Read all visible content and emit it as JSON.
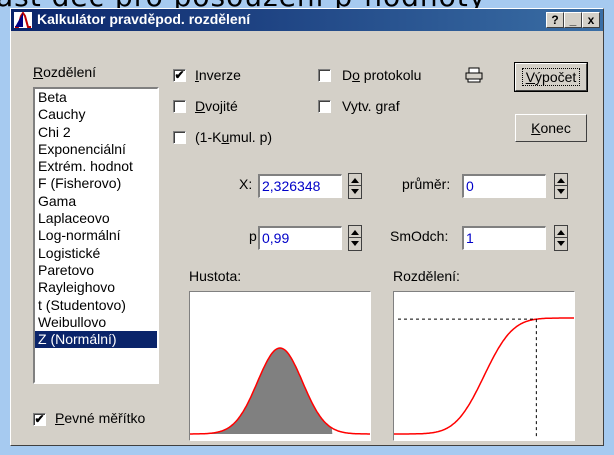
{
  "background": {
    "text": "ast dec pro posouzení p-hodnoty"
  },
  "window": {
    "title": "Kalkulátor pravděpod. rozdělení",
    "help_label": "?",
    "minimize_label": "_",
    "close_label": "x"
  },
  "distribution": {
    "label_underline": "R",
    "label_rest": "ozdělení",
    "items": [
      "Beta",
      "Cauchy",
      "Chi 2",
      "Exponenciální",
      "Extrém. hodnot",
      "F (Fisherovo)",
      "Gama",
      "Laplaceovo",
      "Log-normální",
      "Logistické",
      "Paretovo",
      "Rayleighovo",
      "t (Studentovo)",
      "Weibullovo",
      "Z (Normální)"
    ],
    "selected": "Z (Normální)"
  },
  "options": {
    "inverze": {
      "u": "I",
      "rest": "nverze",
      "checked": true
    },
    "dvojite": {
      "u": "D",
      "rest": "vojité",
      "checked": false
    },
    "kumul": {
      "pre": "(1-K",
      "u": "u",
      "rest": "mul. p)",
      "checked": false
    },
    "protokol": {
      "pre": "D",
      "u": "o",
      "rest": " protokolu",
      "checked": false
    },
    "graf": {
      "pre": "Vytv. ",
      "u": "g",
      "rest": "raf",
      "checked": false
    }
  },
  "buttons": {
    "vypocet": {
      "u": "V",
      "rest": "ýpočet"
    },
    "konec": {
      "u": "K",
      "rest": "onec"
    }
  },
  "fields": {
    "x_label": "X:",
    "x_value": "2,326348",
    "p_label": "p:",
    "p_value": "0,99",
    "prumer_label": "průměr:",
    "prumer_value": "0",
    "smodch_label": "SmOdch:",
    "smodch_value": "1"
  },
  "plots": {
    "density_label": "Hustota:",
    "cdf_label": "Rozdělení:"
  },
  "fixed_scale": {
    "u": "P",
    "rest": "evné měřítko",
    "checked": true
  },
  "chart_data": {
    "type": "area",
    "distribution": "Z (Normální)",
    "mean": 0,
    "sd": 1,
    "p": 0.99,
    "x_critical": 2.326348,
    "density_title": "Hustota:",
    "cdf_title": "Rozdělení:",
    "colors": {
      "curve": "#ff0000",
      "fill": "#808080",
      "marker": "#000000"
    }
  }
}
